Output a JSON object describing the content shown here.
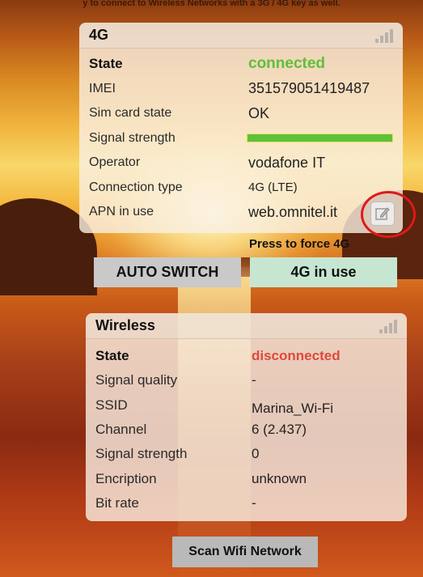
{
  "top_note": "y to connect to Wireless Networks with a 3G / 4G key as well.",
  "lte": {
    "title": "4G",
    "signal_icon": "signal-bars-icon",
    "rows": [
      {
        "label": "State",
        "value": "connected"
      },
      {
        "label": "IMEI",
        "value": "351579051419487"
      },
      {
        "label": "Sim card state",
        "value": "OK"
      },
      {
        "label": "Signal strength",
        "value": ""
      },
      {
        "label": "Operator",
        "value": "vodafone IT"
      },
      {
        "label": "Connection type",
        "value": "4G (LTE)"
      },
      {
        "label": "APN in use",
        "value": "web.omnitel.it"
      }
    ],
    "signal_strength_level": 1.0,
    "edit_icon": "edit-icon"
  },
  "hint": "Press to force 4G",
  "buttons": {
    "auto_switch": "AUTO SWITCH",
    "lte_in_use": "4G in use",
    "scan": "Scan Wifi Network"
  },
  "wifi": {
    "title": "Wireless",
    "signal_icon": "signal-bars-icon",
    "rows": [
      {
        "label": "State",
        "value": "disconnected"
      },
      {
        "label": "Signal quality",
        "value": "-"
      },
      {
        "label": "SSID",
        "value": "Marina_Wi-Fi"
      },
      {
        "label": "Channel",
        "value": "6 (2.437)"
      },
      {
        "label": "Signal strength",
        "value": "0"
      },
      {
        "label": "Encription",
        "value": "unknown"
      },
      {
        "label": "Bit rate",
        "value": "-"
      }
    ]
  },
  "colors": {
    "connected": "#5fbf3a",
    "disconnected": "#e0483c",
    "highlight_circle": "#e01818"
  }
}
